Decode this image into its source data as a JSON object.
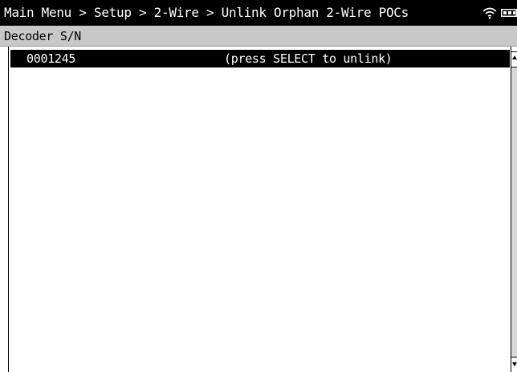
{
  "header": {
    "breadcrumb": "Main Menu > Setup > 2-Wire > Unlink Orphan 2-Wire POCs",
    "status_icons": [
      "wifi-icon",
      "battery-icon"
    ]
  },
  "column_header": {
    "label": "Decoder S/N"
  },
  "list": {
    "rows": [
      {
        "serial": "0001245",
        "hint": "(press SELECT to unlink)",
        "selected": true
      }
    ]
  },
  "colors": {
    "title_bar_bg": "#000000",
    "title_bar_fg": "#ffffff",
    "header_bg": "#c8c8c8",
    "selected_row_bg": "#000000",
    "selected_row_fg": "#ffffff",
    "background": "#ffffff"
  }
}
